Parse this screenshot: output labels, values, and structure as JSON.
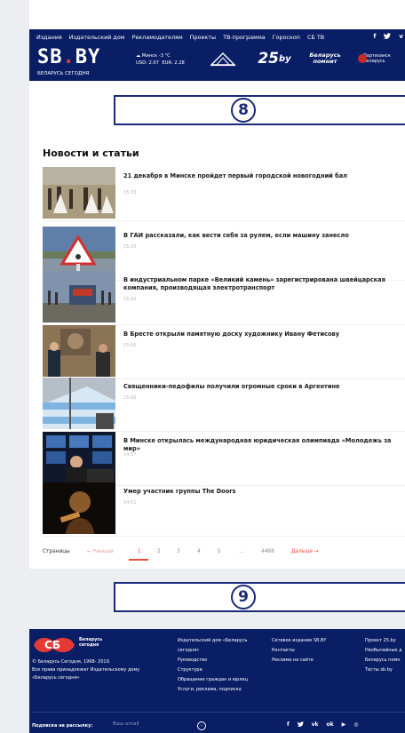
{
  "header": {
    "nav": [
      "Издания",
      "Издательский дом",
      "Рекламодателям",
      "Проекты",
      "ТВ-программа",
      "Гороскоп",
      "СБ ТВ"
    ],
    "social": [
      "f",
      "🐦",
      "v"
    ],
    "logo": {
      "left": "SB",
      "dot": ".",
      "right": "BY"
    },
    "logo_subtitle": "БЕЛАРУСЬ СЕГОДНЯ",
    "weather": {
      "city_temp": "Минск -3 °C",
      "usd": "USD: 2.07",
      "eur": "EUR: 2.28"
    },
    "partners": {
      "p2_main": "25",
      "p2_sub": "by",
      "p3_line1": "Беларусь",
      "p3_line2": "помнит",
      "p4_line1": "Партизанск",
      "p4_line2": "Беларусь"
    }
  },
  "banners": {
    "top": "8",
    "bottom": "9"
  },
  "news": {
    "section_title": "Новости и статьи",
    "items": [
      {
        "title": "21 декабря в Минске пройдет первый городской новогодний бал",
        "time": "15:33"
      },
      {
        "title": "В ГАИ рассказали, как вести себя за рулем, если машину занесло",
        "time": "15:25"
      },
      {
        "title": "В индустриальном парке «Великий камень» зарегистрирована швейцарская компания, производящая электротранспорт",
        "time": "15:20"
      },
      {
        "title": "В Бресте открыли памятную доску художнику Ивану Фетисову",
        "time": "15:05"
      },
      {
        "title": "Священники-педофилы получили огромные сроки в Аргентине",
        "time": "15:00"
      },
      {
        "title": "В Минске открылась международная юридическая олимпиада «Молодежь за мир»",
        "time": "14:57"
      },
      {
        "title": "Умер участник группы The Doors",
        "time": "14:51"
      }
    ]
  },
  "pagination": {
    "label": "Страницы",
    "prev": "← Раньше",
    "pages": [
      "1",
      "2",
      "3",
      "4",
      "5",
      "...",
      "4468"
    ],
    "next": "Дальше →"
  },
  "footer": {
    "logo_line1": "Беларусь",
    "logo_line2": "сегодня",
    "copyright_lines": [
      "© Беларусь Сегодня, 1998- 2019.",
      "Все права принадлежат Издательскому дому",
      "«Беларусь сегодня»"
    ],
    "col1": [
      "Издательский дом «Беларусь",
      "сегодня»",
      "Руководство",
      "Структура",
      "Обращение граждан и юрлиц",
      "Услуги, реклама, подписка"
    ],
    "col2": [
      "Сетевое издание SB.BY",
      "Контакты",
      "Реклама на сайте"
    ],
    "col3": [
      "Проект 25.by",
      "Необычайные д",
      "Беларусь помн",
      "Тесты sb.by"
    ],
    "subscribe_label": "Подписка на рассылку:",
    "email_placeholder": "Ваш email",
    "social": [
      "f",
      "🐦",
      "vk",
      "ok",
      "▶",
      "◎"
    ]
  },
  "colors": {
    "header_bg": "#0a1e66",
    "accent": "#e74c3c",
    "banner_border": "#1b2a78"
  }
}
